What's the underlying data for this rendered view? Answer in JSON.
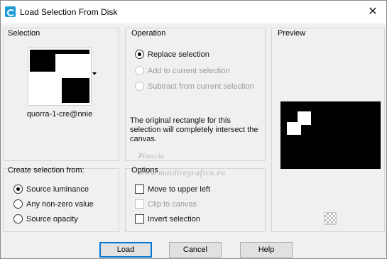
{
  "window": {
    "title": "Load Selection From Disk",
    "close_glyph": "✕",
    "icon": "paint-shop-pro-icon"
  },
  "selection": {
    "label": "Selection",
    "file_name": "quorra-1-cre@nnie"
  },
  "operation": {
    "label": "Operation",
    "options": [
      {
        "label": "Replace selection",
        "checked": true,
        "enabled": true
      },
      {
        "label": "Add to current selection",
        "checked": false,
        "enabled": false
      },
      {
        "label": "Subtract from current selection",
        "checked": false,
        "enabled": false
      }
    ],
    "info": "The original rectangle for this selection will completely intersect the canvas."
  },
  "preview": {
    "label": "Preview",
    "background_icon": "checkerboard-icon"
  },
  "create_from": {
    "label": "Create selection from:",
    "options": [
      {
        "label": "Source luminance",
        "checked": true
      },
      {
        "label": "Any non-zero value",
        "checked": false
      },
      {
        "label": "Source opacity",
        "checked": false
      }
    ]
  },
  "options": {
    "label": "Options",
    "items": [
      {
        "label": "Move to upper left",
        "checked": false,
        "enabled": true
      },
      {
        "label": "Clip to canvas",
        "checked": false,
        "enabled": false
      },
      {
        "label": "Invert selection",
        "checked": false,
        "enabled": true
      }
    ]
  },
  "buttons": {
    "load": "Load",
    "cancel": "Cancel",
    "help": "Help"
  },
  "watermark": {
    "line1": "Pinuccia",
    "line2": "www.maidiregrafica.eu"
  },
  "colors": {
    "dialog_bg": "#f0f0f0",
    "accent": "#0078d7",
    "icon_blue": "#1d9bd6"
  }
}
